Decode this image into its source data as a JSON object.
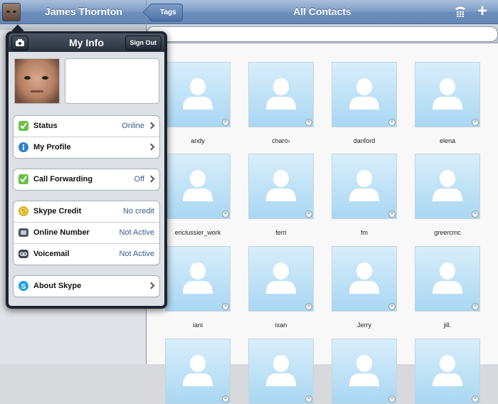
{
  "sidebar": {
    "user_name": "James Thornton"
  },
  "header": {
    "tags_label": "Tags",
    "title": "All Contacts",
    "dialpad_icon": "dialpad-icon",
    "add_icon": "plus-icon"
  },
  "search": {
    "placeholder": ""
  },
  "contacts": [
    {
      "name": "andy"
    },
    {
      "name": "charo›"
    },
    {
      "name": "danford"
    },
    {
      "name": "elena"
    },
    {
      "name": "ericlussier_work"
    },
    {
      "name": "ferri"
    },
    {
      "name": "fm"
    },
    {
      "name": "greercmc"
    },
    {
      "name": "iani"
    },
    {
      "name": "ixan"
    },
    {
      "name": "Jerry"
    },
    {
      "name": "jill."
    },
    {
      "name": ""
    },
    {
      "name": ""
    },
    {
      "name": ""
    },
    {
      "name": ""
    }
  ],
  "my_info": {
    "title": "My Info",
    "sign_out_label": "Sign Out",
    "camera_icon": "camera-icon",
    "groups": [
      {
        "rows": [
          {
            "label": "Status",
            "value": "Online",
            "icon": "online-check-icon",
            "arrow": true
          },
          {
            "label": "My Profile",
            "value": "",
            "icon": "info-icon",
            "arrow": true
          }
        ]
      },
      {
        "rows": [
          {
            "label": "Call Forwarding",
            "value": "Off",
            "icon": "forward-check-icon",
            "arrow": true
          }
        ]
      },
      {
        "rows": [
          {
            "label": "Skype Credit",
            "value": "No credit",
            "icon": "credit-icon",
            "arrow": false
          },
          {
            "label": "Online Number",
            "value": "Not Active",
            "icon": "online-number-icon",
            "arrow": false
          },
          {
            "label": "Voicemail",
            "value": "Not Active",
            "icon": "voicemail-icon",
            "arrow": false
          }
        ]
      },
      {
        "rows": [
          {
            "label": "About Skype",
            "value": "",
            "icon": "skype-icon",
            "arrow": true
          }
        ]
      }
    ]
  },
  "colors": {
    "toolbar_blue": "#6d8fbd",
    "value_blue": "#3a5a8a",
    "status_green": "#5fb53a",
    "contact_bg": "#a9d7f2"
  }
}
